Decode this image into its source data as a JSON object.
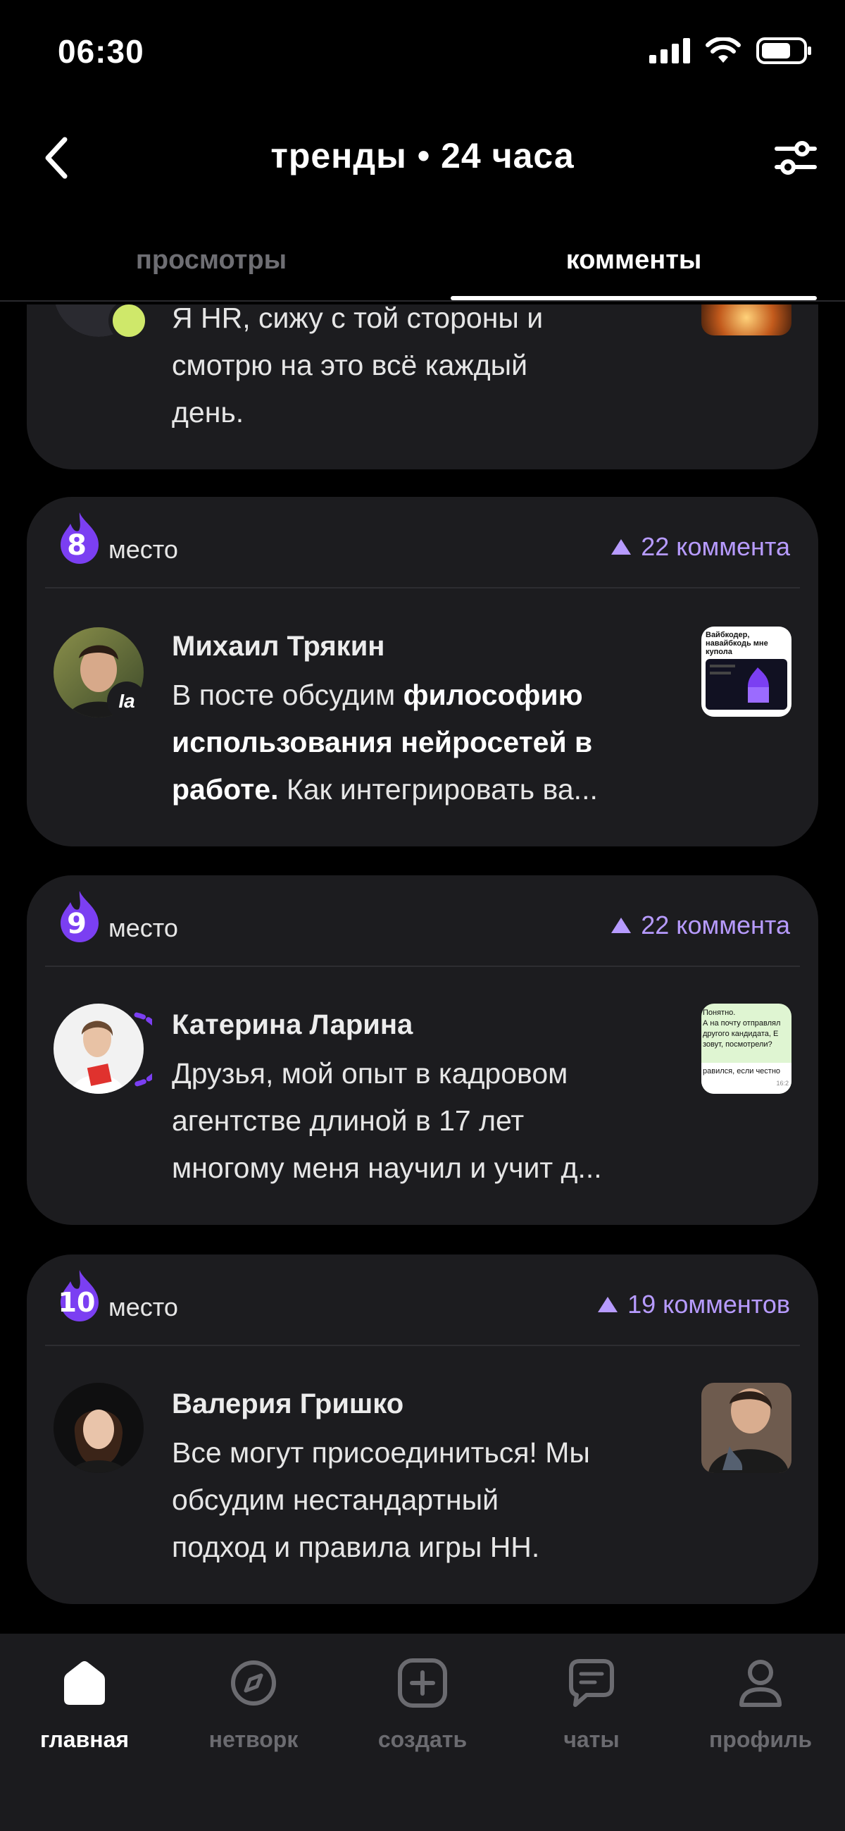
{
  "status": {
    "time": "06:30"
  },
  "header": {
    "title": "тренды • 24 часа"
  },
  "tabs": [
    {
      "label": "просмотры",
      "active": false
    },
    {
      "label": "комменты",
      "active": true
    }
  ],
  "cards": [
    {
      "text_lines": [
        "Я HR, сижу с той стороны и",
        "смотрю на это всё каждый",
        "день."
      ]
    },
    {
      "rank": "8",
      "rank_label": "место",
      "count": "22 коммента",
      "author": "Михаил Трякин",
      "avatar_badge": "Ia",
      "text_part1": "В посте обсудим ",
      "text_bold": "философию использования нейросетей в работе.",
      "text_part2": " Как интегрировать ва..."
    },
    {
      "rank": "9",
      "rank_label": "место",
      "count": "22 коммента",
      "author": "Катерина Ларина",
      "text_lines": [
        "Друзья, мой опыт в кадровом",
        "агентстве длиной в 17 лет",
        "многому меня научил и учит д..."
      ],
      "thumb_text": [
        "Понятно.",
        "А на почту отправлял",
        "другого кандидата, Е",
        "зовут, посмотрели?",
        "равился, если честно",
        "16:2"
      ]
    },
    {
      "rank": "10",
      "rank_label": "место",
      "count": "19 комментов",
      "author": "Валерия Гришко",
      "text_lines": [
        "Все могут присоединиться! Мы",
        "обсудим нестандартный",
        "подход и правила игры HH."
      ]
    }
  ],
  "thumb_card8": [
    "Вайбкодер,",
    "навайбкодь мне",
    "купола"
  ],
  "bottom_nav": [
    {
      "label": "главная",
      "icon": "home-icon",
      "active": true
    },
    {
      "label": "нетворк",
      "icon": "compass-icon",
      "active": false
    },
    {
      "label": "создать",
      "icon": "plus-square-icon",
      "active": false
    },
    {
      "label": "чаты",
      "icon": "chat-icon",
      "active": false
    },
    {
      "label": "профиль",
      "icon": "user-icon",
      "active": false
    }
  ],
  "colors": {
    "accent": "#b79bff",
    "flame": "#7b3ff2",
    "card": "#1c1c1f",
    "background": "#000000"
  }
}
